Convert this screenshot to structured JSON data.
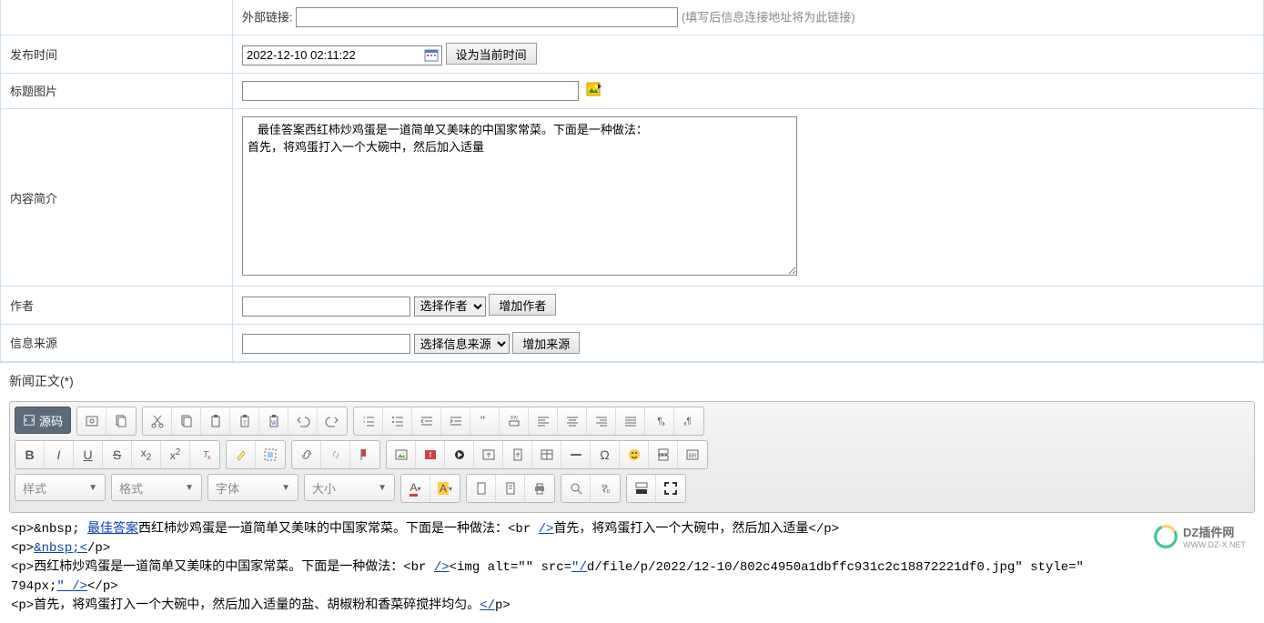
{
  "labels": {
    "external_link": "外部链接:",
    "external_hint": "(填写后信息连接地址将为此链接)",
    "publish_time": "发布时间",
    "title_image": "标题图片",
    "intro": "内容简介",
    "author": "作者",
    "source": "信息来源",
    "news_body": "新闻正文(*)"
  },
  "fields": {
    "publish_time_value": "2022-12-10 02:11:22",
    "set_now_btn": "设为当前时间",
    "title_image_value": "",
    "intro_value": "   最佳答案西红柿炒鸡蛋是一道简单又美味的中国家常菜。下面是一种做法：\n首先，将鸡蛋打入一个大碗中，然后加入适量",
    "author_value": "",
    "source_value": ""
  },
  "selects": {
    "author_placeholder": "选择作者",
    "source_placeholder": "选择信息来源"
  },
  "buttons": {
    "add_author": "增加作者",
    "add_source": "增加来源"
  },
  "editor": {
    "source_label": "源码",
    "combos": {
      "style": "样式",
      "format": "格式",
      "font": "字体",
      "size": "大小"
    },
    "content_lines": [
      {
        "prefix": "<p>&nbsp; ",
        "underlined": "最佳答案",
        "rest": "西红柿炒鸡蛋是一道简单又美味的中国家常菜。下面是一种做法：<br ",
        "u2": "/>",
        "rest2": "首先，将鸡蛋打入一个大碗中，然后加入适量</p>"
      },
      {
        "prefix": "<p>",
        "underlined": "&nbsp;<",
        "rest": "/p>"
      },
      {
        "prefix": "<p>西红柿炒鸡蛋是一道简单又美味的中国家常菜。下面是一种做法：<br ",
        "u2": "/>",
        "rest": "<img alt=\"\" src=",
        "u3": "\"/",
        "rest2": "d/file/p/2022/12-10/802c4950a1dbffc931c2c18872221df0.jpg\" style=\""
      },
      {
        "prefix": "794px;",
        "u2": "\" />",
        "rest": "</p>"
      },
      {
        "prefix": "<p>首先，将鸡蛋打入一个大碗中，然后加入适量的盐、胡椒粉和香菜碎搅拌均匀。",
        "u2": "</",
        "rest": "p>"
      }
    ]
  },
  "watermark": {
    "text": "DZ插件网",
    "sub": "WWW.DZ-X.NET"
  }
}
